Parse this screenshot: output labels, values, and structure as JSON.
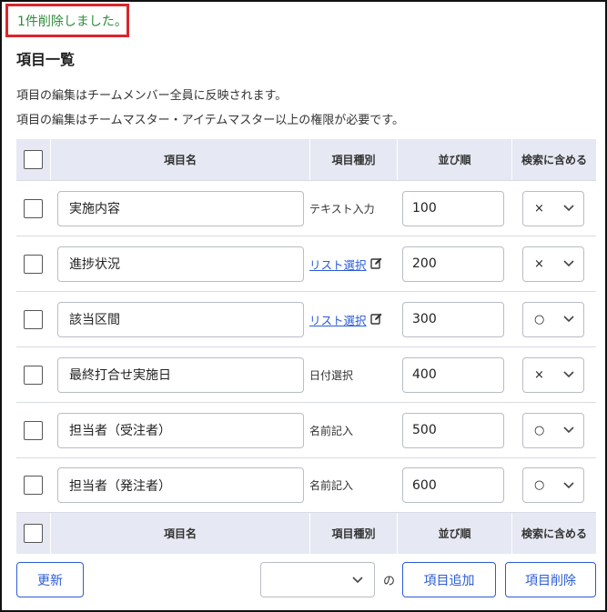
{
  "flash_message": "1件削除しました。",
  "page_title": "項目一覧",
  "descriptions": [
    "項目の編集はチームメンバー全員に反映されます。",
    "項目の編集はチームマスター・アイテムマスター以上の権限が必要です。"
  ],
  "table": {
    "headers": {
      "name": "項目名",
      "type": "項目種別",
      "order": "並び順",
      "search": "検索に含める"
    },
    "rows": [
      {
        "name": "実施内容",
        "type": "テキスト入力",
        "type_is_link": false,
        "order": "100",
        "search": "×"
      },
      {
        "name": "進捗状況",
        "type": "リスト選択",
        "type_is_link": true,
        "order": "200",
        "search": "×"
      },
      {
        "name": "該当区間",
        "type": "リスト選択",
        "type_is_link": true,
        "order": "300",
        "search": "○"
      },
      {
        "name": "最終打合せ実施日",
        "type": "日付選択",
        "type_is_link": false,
        "order": "400",
        "search": "×"
      },
      {
        "name": "担当者（受注者）",
        "type": "名前記入",
        "type_is_link": false,
        "order": "500",
        "search": "○"
      },
      {
        "name": "担当者（発注者）",
        "type": "名前記入",
        "type_is_link": false,
        "order": "600",
        "search": "○"
      }
    ]
  },
  "footer": {
    "refresh_label": "更新",
    "position_select_value": "",
    "position_suffix": "の",
    "add_label": "項目追加",
    "delete_label": "項目削除"
  },
  "icons": {
    "edit": "edit-icon",
    "dropdown": "chevron-down-icon"
  },
  "colors": {
    "flash_border": "#d9262c",
    "flash_text": "#2e8b3a",
    "accent": "#2b5bd7",
    "header_bg": "#e6e9f3"
  }
}
